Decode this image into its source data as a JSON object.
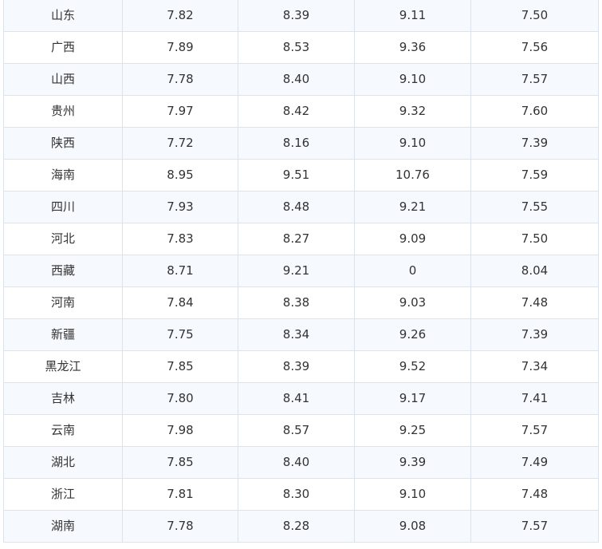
{
  "table": {
    "rows": [
      [
        "山东",
        "7.82",
        "8.39",
        "9.11",
        "7.50"
      ],
      [
        "广西",
        "7.89",
        "8.53",
        "9.36",
        "7.56"
      ],
      [
        "山西",
        "7.78",
        "8.40",
        "9.10",
        "7.57"
      ],
      [
        "贵州",
        "7.97",
        "8.42",
        "9.32",
        "7.60"
      ],
      [
        "陕西",
        "7.72",
        "8.16",
        "9.10",
        "7.39"
      ],
      [
        "海南",
        "8.95",
        "9.51",
        "10.76",
        "7.59"
      ],
      [
        "四川",
        "7.93",
        "8.48",
        "9.21",
        "7.55"
      ],
      [
        "河北",
        "7.83",
        "8.27",
        "9.09",
        "7.50"
      ],
      [
        "西藏",
        "8.71",
        "9.21",
        "0",
        "8.04"
      ],
      [
        "河南",
        "7.84",
        "8.38",
        "9.03",
        "7.48"
      ],
      [
        "新疆",
        "7.75",
        "8.34",
        "9.26",
        "7.39"
      ],
      [
        "黑龙江",
        "7.85",
        "8.39",
        "9.52",
        "7.34"
      ],
      [
        "吉林",
        "7.80",
        "8.41",
        "9.17",
        "7.41"
      ],
      [
        "云南",
        "7.98",
        "8.57",
        "9.25",
        "7.57"
      ],
      [
        "湖北",
        "7.85",
        "8.40",
        "9.39",
        "7.49"
      ],
      [
        "浙江",
        "7.81",
        "8.30",
        "9.10",
        "7.48"
      ],
      [
        "湖南",
        "7.78",
        "8.28",
        "9.08",
        "7.57"
      ]
    ]
  },
  "colors": {
    "row_alt_background": "#f6f9fe",
    "row_background": "#ffffff",
    "border": "#dde3ea",
    "text": "#333333"
  }
}
